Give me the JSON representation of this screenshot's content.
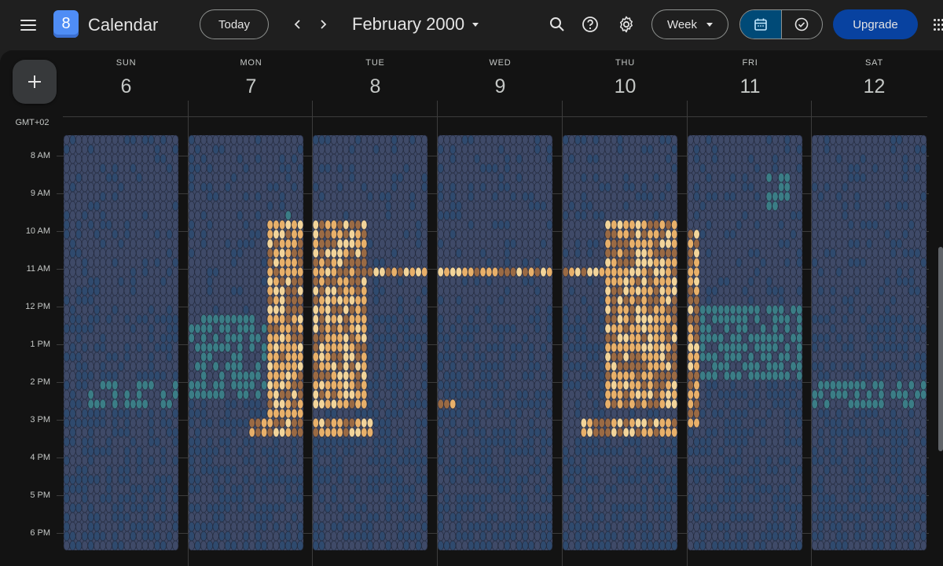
{
  "header": {
    "app_title": "Calendar",
    "logo_day": "8",
    "today_label": "Today",
    "date_title": "February 2000",
    "view_label": "Week",
    "upgrade_label": "Upgrade"
  },
  "timezone": "GMT+02",
  "days": [
    {
      "name": "SUN",
      "num": "6"
    },
    {
      "name": "MON",
      "num": "7"
    },
    {
      "name": "TUE",
      "num": "8"
    },
    {
      "name": "WED",
      "num": "9"
    },
    {
      "name": "THU",
      "num": "10"
    },
    {
      "name": "FRI",
      "num": "11"
    },
    {
      "name": "SAT",
      "num": "12"
    }
  ],
  "hours": [
    "8 AM",
    "9 AM",
    "10 AM",
    "11 AM",
    "12 PM",
    "1 PM",
    "2 PM",
    "3 PM",
    "4 PM",
    "5 PM",
    "6 PM"
  ],
  "colors": {
    "bg": "#131313",
    "accent": "#0842a0",
    "event_base": "#3f4a68",
    "event_blue": "#2f4a6e",
    "event_teal": "#3b7d86",
    "event_tan": "#e8b06a",
    "event_brown": "#9a6a44",
    "event_light": "#f2d49a"
  }
}
